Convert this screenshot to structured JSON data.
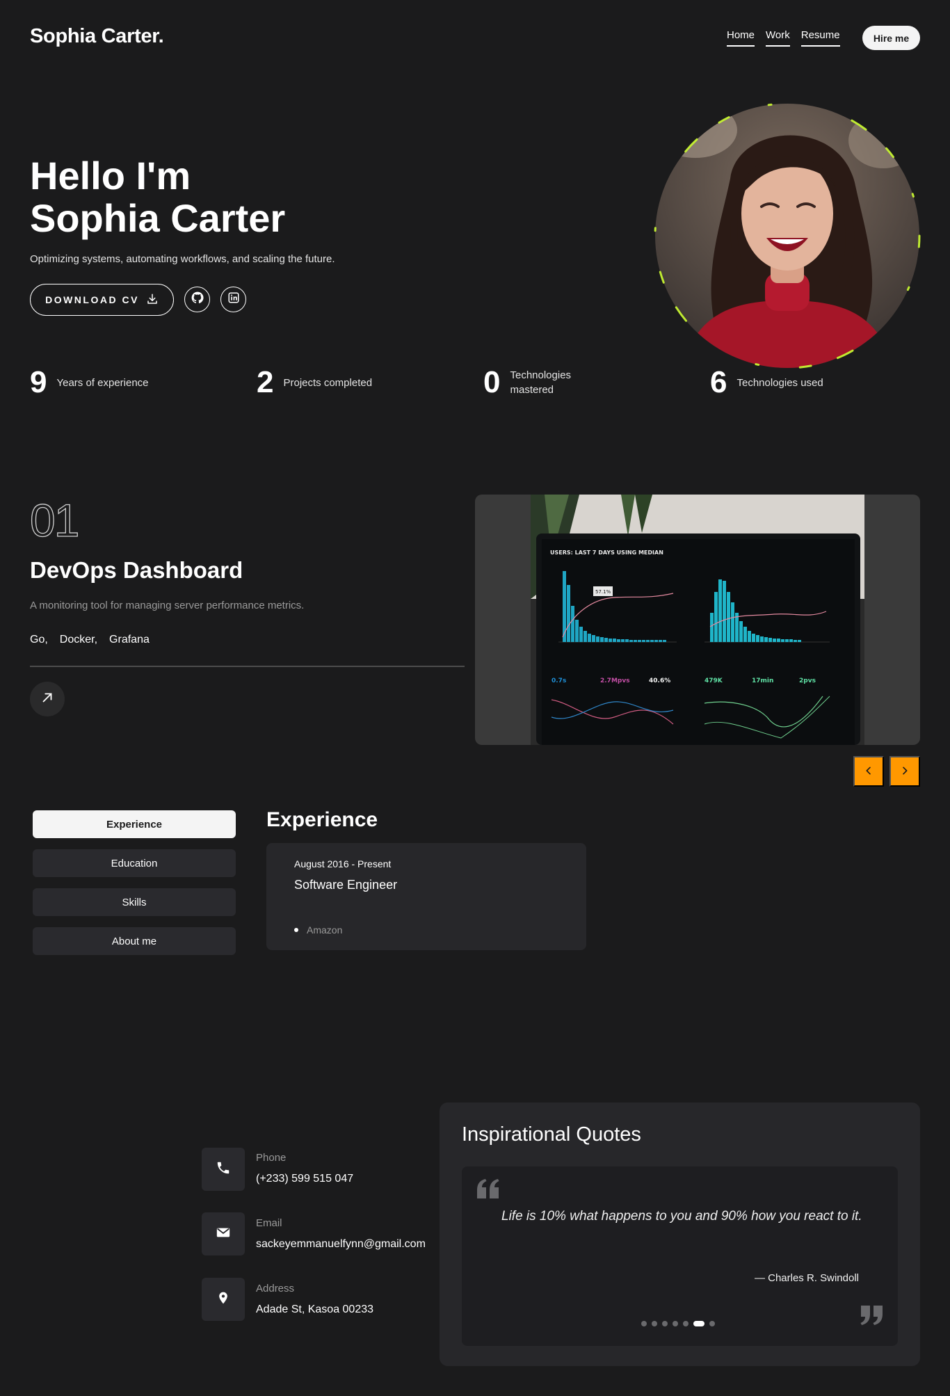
{
  "header": {
    "logo": "Sophia Carter.",
    "nav": [
      "Home",
      "Work",
      "Resume"
    ],
    "hire_label": "Hire me"
  },
  "hero": {
    "greeting": "Hello I'm",
    "name": "Sophia Carter",
    "subtitle": "Optimizing systems, automating workflows, and scaling the future.",
    "cv_label": "DOWNLOAD CV",
    "icons": [
      "download-icon",
      "github-icon",
      "linkedin-icon"
    ],
    "ring_color": "#c6f432"
  },
  "stats": [
    {
      "num": "9",
      "label": "Years of experience"
    },
    {
      "num": "2",
      "label": "Projects completed"
    },
    {
      "num": "0",
      "label": "Technologies mastered"
    },
    {
      "num": "6",
      "label": "Technologies used"
    }
  ],
  "project": {
    "number": "01",
    "title": "DevOps Dashboard",
    "description": "A monitoring tool for managing server performance metrics.",
    "tech": [
      "Go,",
      "Docker,",
      "Grafana"
    ],
    "screen": {
      "header": "USERS: LAST 7 DAYS USING MEDIAN",
      "tooltip": "57.1%",
      "metrics": [
        "0.7s",
        "2.7Mpvs",
        "40.6%",
        "479K",
        "17min",
        "2pvs"
      ]
    },
    "accent": "#ff9800"
  },
  "resume": {
    "tabs": [
      "Experience",
      "Education",
      "Skills",
      "About me"
    ],
    "title": "Experience",
    "item": {
      "date": "August 2016 - Present",
      "role": "Software Engineer",
      "company": "Amazon"
    }
  },
  "contact": {
    "phone_label": "Phone",
    "phone": "(+233) 599 515 047",
    "email_label": "Email",
    "email": "sackeyemmanuelfynn@gmail.com",
    "address_label": "Address",
    "address": "Adade St, Kasoa 00233"
  },
  "quotes": {
    "title": "Inspirational Quotes",
    "text": "Life is 10% what happens to you and 90% how you react to it.",
    "author": "— Charles R. Swindoll",
    "total": 7,
    "active_index": 5
  }
}
